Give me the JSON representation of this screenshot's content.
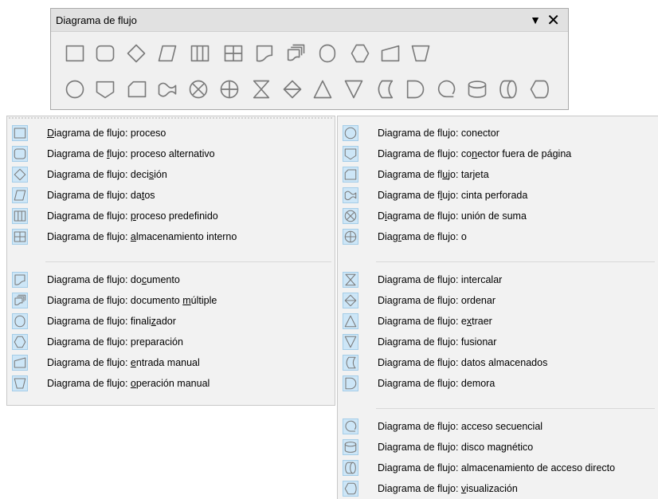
{
  "toolbar": {
    "title": "Diagrama de flujo",
    "dropdown_icon": "triangle-down-icon",
    "close_icon": "close-icon",
    "row1": [
      "process",
      "alt-process",
      "decision",
      "data",
      "predefined",
      "internal-storage",
      "document",
      "multidocument",
      "terminator",
      "preparation",
      "manual-input",
      "manual-operation"
    ],
    "row2": [
      "connector",
      "offpage",
      "card",
      "punched-tape",
      "summing",
      "or",
      "collate",
      "sort",
      "extract",
      "merge",
      "stored-data",
      "delay",
      "sequential",
      "magnetic-disk",
      "direct-access",
      "display"
    ]
  },
  "menu_left": {
    "items": [
      {
        "pre": "",
        "u": "D",
        "post": "iagrama de flujo: proceso",
        "icon": "process"
      },
      {
        "pre": "Diagrama de ",
        "u": "f",
        "post": "lujo: proceso alternativo",
        "icon": "alt-process"
      },
      {
        "pre": "Diagrama de flujo: deci",
        "u": "s",
        "post": "ión",
        "icon": "decision"
      },
      {
        "pre": "Diagrama de flujo: da",
        "u": "t",
        "post": "os",
        "icon": "data"
      },
      {
        "pre": "Diagrama de flujo: ",
        "u": "p",
        "post": "roceso predefinido",
        "icon": "predefined"
      },
      {
        "pre": "Diagrama de flujo: ",
        "u": "a",
        "post": "lmacenamiento interno",
        "icon": "internal-storage"
      },
      {
        "pre": "Diagrama de flujo: do",
        "u": "c",
        "post": "umento",
        "icon": "document"
      },
      {
        "pre": "Diagrama de flujo: documento ",
        "u": "m",
        "post": "últiple",
        "icon": "multidocument"
      },
      {
        "pre": "Diagrama de flujo: finali",
        "u": "z",
        "post": "ador",
        "icon": "terminator"
      },
      {
        "pre": "Diagrama de flujo: preparación",
        "u": "",
        "post": "",
        "icon": "preparation"
      },
      {
        "pre": "Diagrama de flujo: ",
        "u": "e",
        "post": "ntrada manual",
        "icon": "manual-input"
      },
      {
        "pre": "Diagrama de flujo: ",
        "u": "o",
        "post": "peración manual",
        "icon": "manual-operation"
      }
    ]
  },
  "menu_right": {
    "items": [
      {
        "pre": "Dia",
        "u": "g",
        "post": "rama de flujo: conector",
        "icon": "connector"
      },
      {
        "pre": "Diagrama de flujo: co",
        "u": "n",
        "post": "ector fuera de página",
        "icon": "offpage"
      },
      {
        "pre": "Diagrama de fl",
        "u": "u",
        "post": "jo: tarjeta",
        "icon": "card"
      },
      {
        "pre": "Diagrama de f",
        "u": "l",
        "post": "ujo: cinta perforada",
        "icon": "punched-tape"
      },
      {
        "pre": "D",
        "u": "i",
        "post": "agrama de flujo: unión de suma",
        "icon": "summing"
      },
      {
        "pre": "Diag",
        "u": "r",
        "post": "ama de flujo: o",
        "icon": "or"
      },
      {
        "pre": "Diagrama de flujo: intercalar",
        "u": "",
        "post": "",
        "icon": "collate"
      },
      {
        "pre": "Diagrama de flujo: ordenar",
        "u": "",
        "post": "",
        "icon": "sort"
      },
      {
        "pre": "Diagrama de flujo: e",
        "u": "x",
        "post": "traer",
        "icon": "extract"
      },
      {
        "pre": "Diagrama de flujo: fusionar",
        "u": "",
        "post": "",
        "icon": "merge"
      },
      {
        "pre": "Diagrama de flujo: datos almacenados",
        "u": "",
        "post": "",
        "icon": "stored-data"
      },
      {
        "pre": "Diagrama de flujo: demora",
        "u": "",
        "post": "",
        "icon": "delay"
      },
      {
        "pre": "Diagrama de flujo: acceso secuencial",
        "u": "",
        "post": "",
        "icon": "sequential"
      },
      {
        "pre": "Diagrama de flujo: disco magnético",
        "u": "",
        "post": "",
        "icon": "magnetic-disk"
      },
      {
        "pre": "Diagrama de flujo: almacenamiento de acceso directo",
        "u": "",
        "post": "",
        "icon": "direct-access"
      },
      {
        "pre": "Diagrama de flujo: ",
        "u": "v",
        "post": "isualización",
        "icon": "display"
      }
    ]
  }
}
